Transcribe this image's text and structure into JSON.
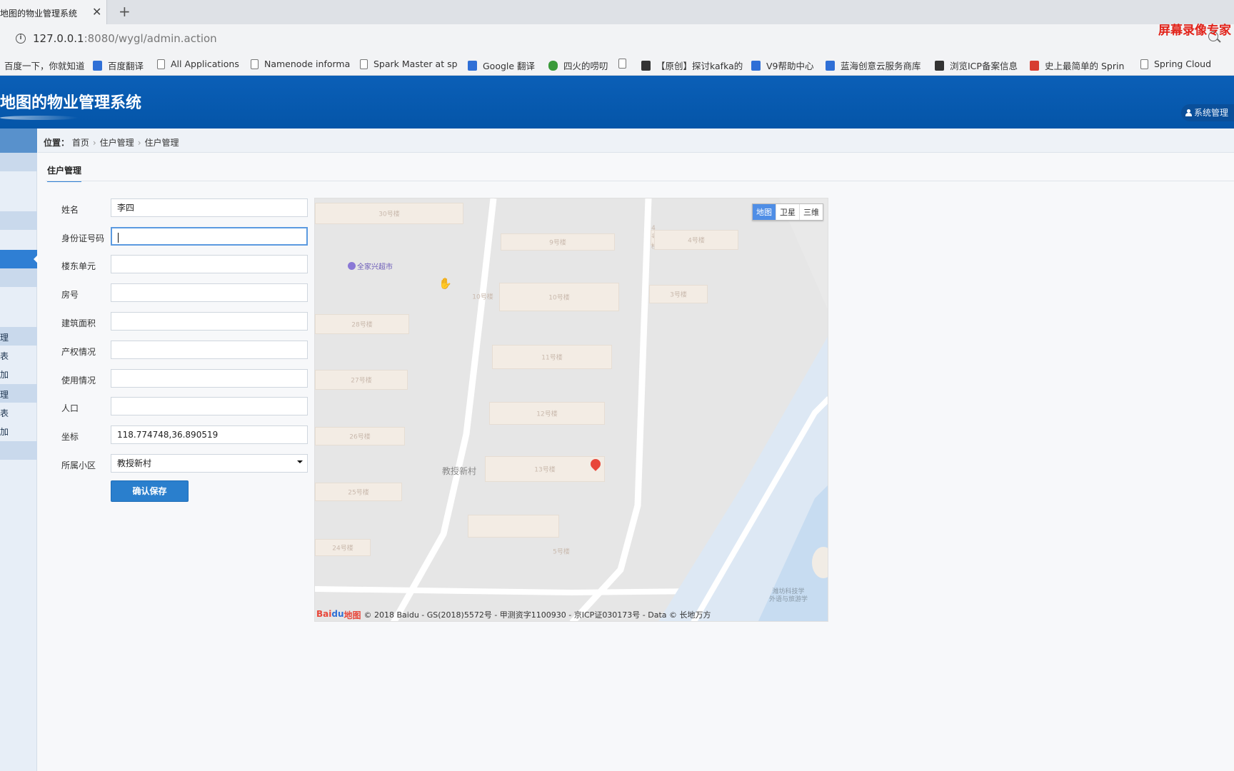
{
  "browser": {
    "tab_title": "地图的物业管理系统",
    "tab_close": "✕",
    "new_tab": "+",
    "url_host": "127.0.0.1",
    "url_rest": ":8080/wygl/admin.action",
    "recorder_watermark": "屏幕录像专家",
    "bookmarks": [
      {
        "label": "百度一下，你就知道",
        "icon": "none"
      },
      {
        "label": "百度翻译",
        "icon": "translate-icon"
      },
      {
        "label": "All Applications",
        "icon": "page-icon"
      },
      {
        "label": "Namenode informa",
        "icon": "page-icon"
      },
      {
        "label": "Spark Master at sp",
        "icon": "page-icon"
      },
      {
        "label": "Google 翻译",
        "icon": "google-translate-icon"
      },
      {
        "label": "四火的唠叨",
        "icon": "leaf-icon"
      },
      {
        "label": "",
        "icon": "chart-icon"
      },
      {
        "label": "【原创】探讨kafka的",
        "icon": "g-icon"
      },
      {
        "label": "V9帮助中心",
        "icon": "pc-icon"
      },
      {
        "label": "蓝海创意云服务商库",
        "icon": "vso-icon"
      },
      {
        "label": "浏览ICP备案信息",
        "icon": "link-icon"
      },
      {
        "label": "史上最简单的 Sprin",
        "icon": "c-icon"
      },
      {
        "label": "Spring Cloud",
        "icon": "page-icon"
      }
    ]
  },
  "header": {
    "title": "地图的物业管理系统",
    "user_menu": "系统管理"
  },
  "sidebar": {
    "labels": [
      "理",
      "表",
      "加",
      "理",
      "表",
      "加"
    ]
  },
  "breadcrumb": {
    "prefix": "位置：",
    "items": [
      "首页",
      "住户管理",
      "住户管理"
    ],
    "sep": "›"
  },
  "content": {
    "tab": "住户管理",
    "form": {
      "name_label": "姓名",
      "name_value": "李四",
      "id_label": "身份证号码",
      "id_value": "",
      "building_label": "楼东单元",
      "building_value": "",
      "room_label": "房号",
      "room_value": "",
      "area_label": "建筑面积",
      "area_value": "",
      "ownership_label": "产权情况",
      "ownership_value": "",
      "usage_label": "使用情况",
      "usage_value": "",
      "population_label": "人口",
      "population_value": "",
      "coord_label": "坐标",
      "coord_value": "118.774748,36.890519",
      "community_label": "所属小区",
      "community_value": "教授新村",
      "save_button": "确认保存"
    }
  },
  "map": {
    "type_buttons": [
      "地图",
      "卫星",
      "三维"
    ],
    "poi": "全家兴超市",
    "area_label": "教授新村",
    "buildings": [
      "30号楼",
      "9号楼",
      "4号楼",
      "4号楼",
      "10号楼",
      "3号楼",
      "28号楼",
      "11号楼",
      "27号楼",
      "12号楼",
      "26号楼",
      "13号楼",
      "25号楼",
      "24号楼",
      "5号楼",
      "10号楼"
    ],
    "water_label_1": "潍坊科技学",
    "water_label_2": "外语与旅游学",
    "logo_1": "Bai",
    "logo_2": "du",
    "logo_3": "地图",
    "copyright": "© 2018 Baidu - GS(2018)5572号 - 甲测资字1100930 - 京ICP证030173号 - Data © 长地万方"
  }
}
